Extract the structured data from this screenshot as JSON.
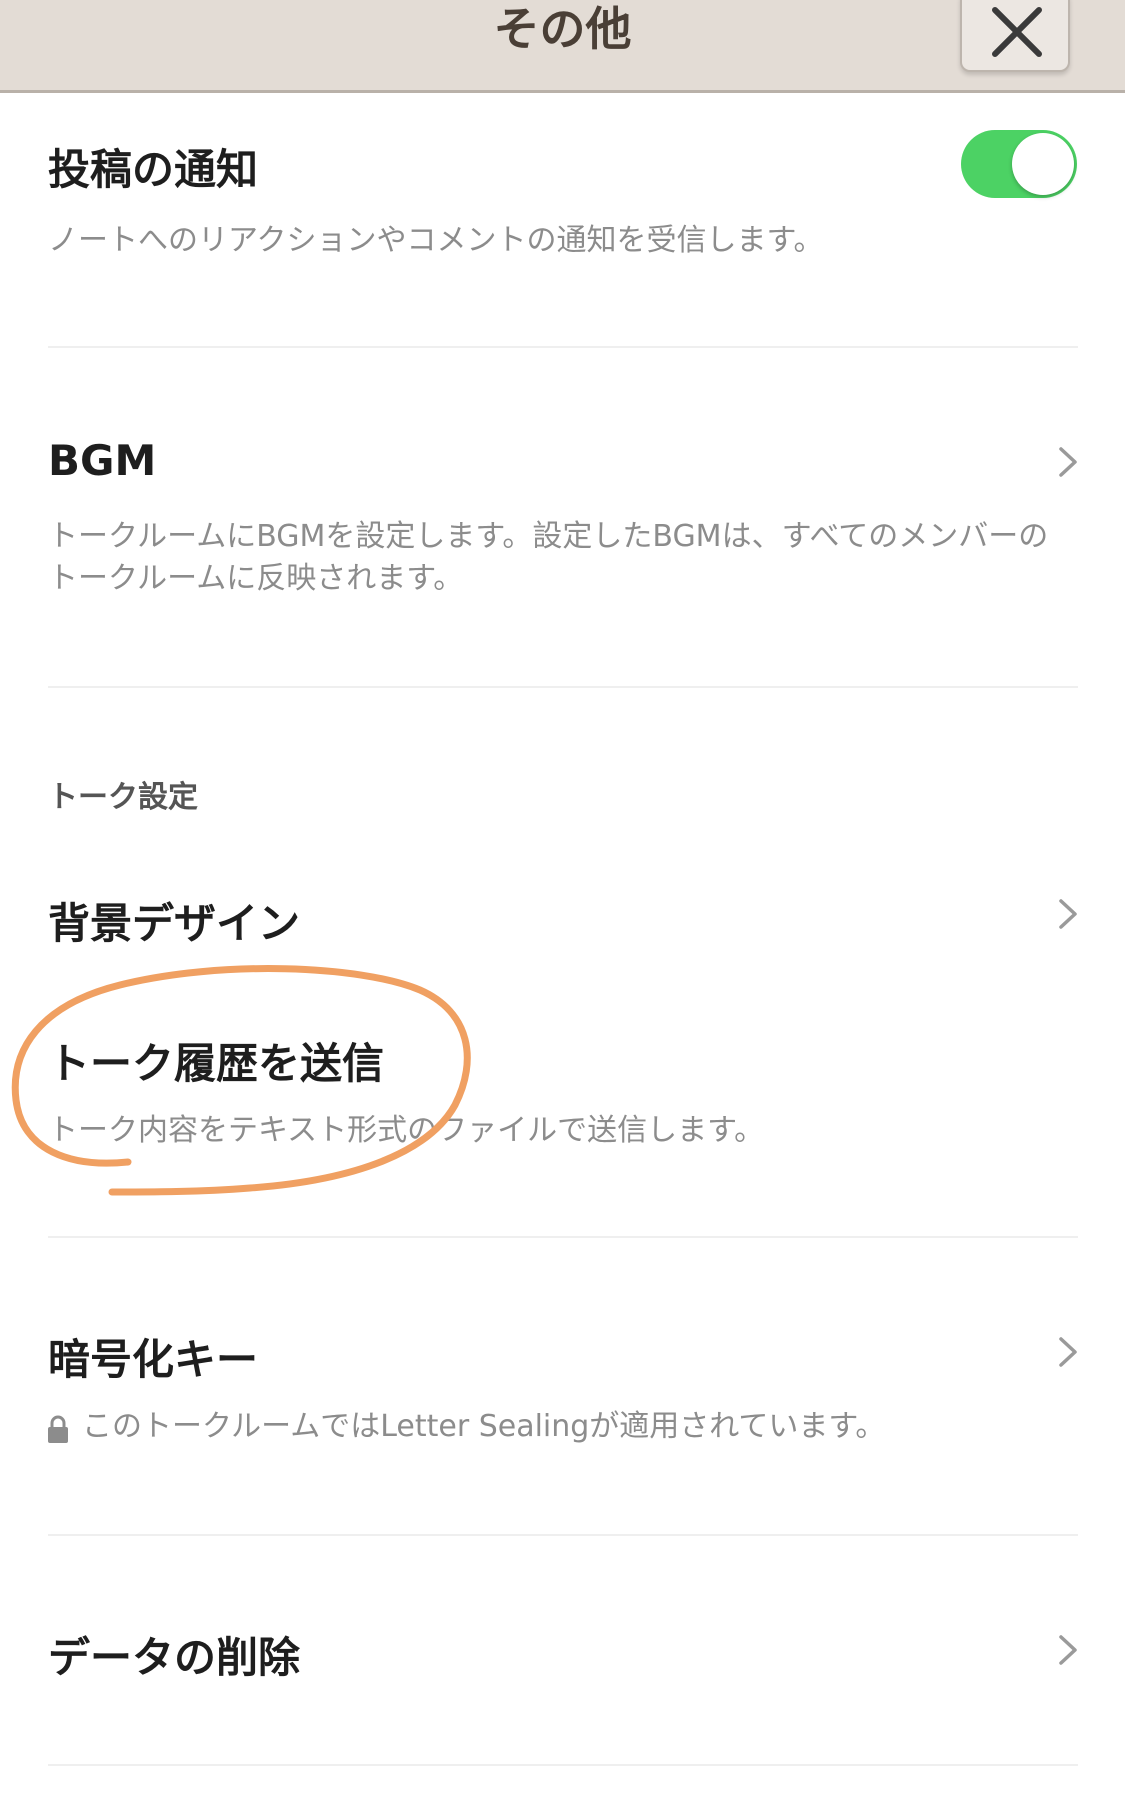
{
  "header": {
    "title": "その他"
  },
  "items": {
    "post_notification": {
      "title": "投稿の通知",
      "description": "ノートへのリアクションやコメントの通知を受信します。",
      "toggle_on": true
    },
    "bgm": {
      "title": "BGM",
      "description": "トークルームにBGMを設定します。設定したBGMは、すべてのメンバーのトークルームに反映されます。"
    },
    "talk_settings_label": "トーク設定",
    "background_design": {
      "title": "背景デザイン"
    },
    "send_history": {
      "title": "トーク履歴を送信",
      "description": "トーク内容をテキスト形式のファイルで送信します。"
    },
    "encryption_key": {
      "title": "暗号化キー",
      "description": "このトークルームではLetter Sealingが適用されています。"
    },
    "delete_data": {
      "title": "データの削除"
    }
  },
  "colors": {
    "toggle_on": "#4cd264",
    "header_bg": "#e3dcd5",
    "annotation": "#f0a062"
  }
}
